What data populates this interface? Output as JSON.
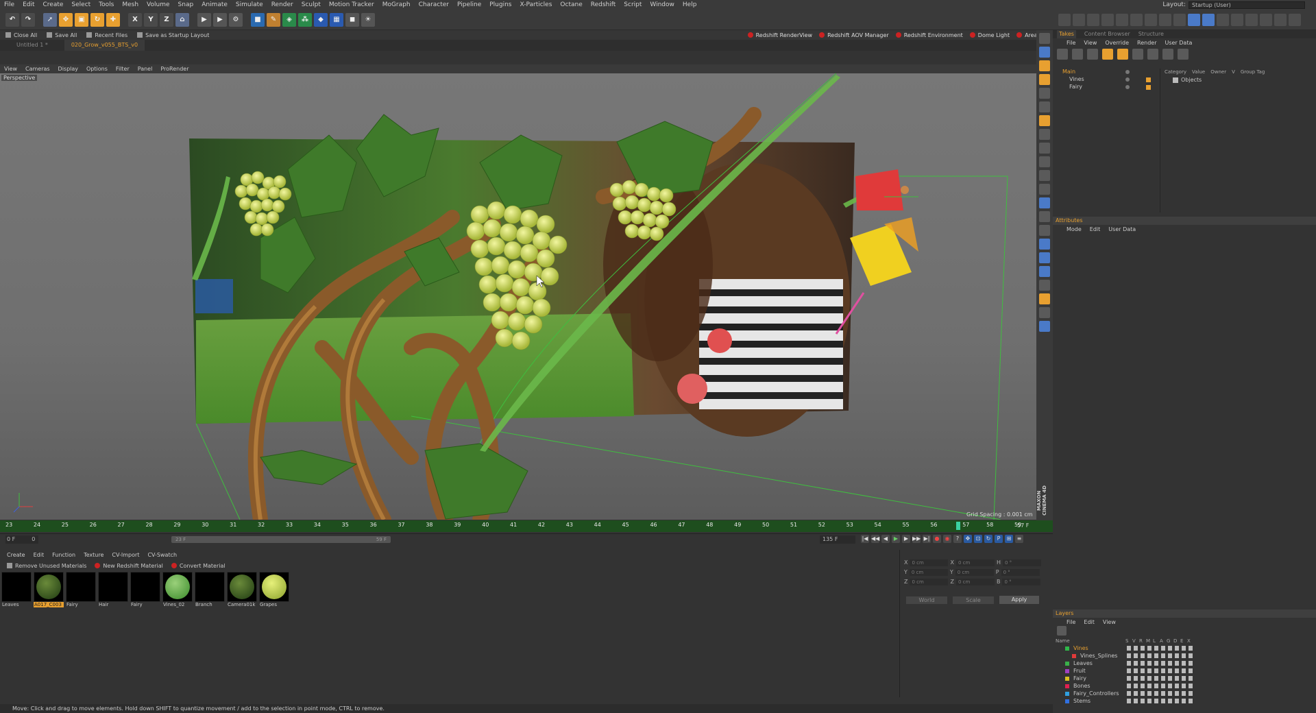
{
  "menu": [
    "File",
    "Edit",
    "Create",
    "Select",
    "Tools",
    "Mesh",
    "Volume",
    "Snap",
    "Animate",
    "Simulate",
    "Render",
    "Sculpt",
    "Motion Tracker",
    "MoGraph",
    "Character",
    "Pipeline",
    "Plugins",
    "X-Particles",
    "Octane",
    "Redshift",
    "Script",
    "Window",
    "Help"
  ],
  "layout": {
    "label": "Layout:",
    "value": "Startup (User)"
  },
  "bar2": {
    "close_all": "Close All",
    "save_all": "Save All",
    "recent_files": "Recent Files",
    "save_startup": "Save as Startup Layout"
  },
  "redshift_buttons": [
    "Redshift RenderView",
    "Redshift AOV Manager",
    "Redshift Environment",
    "Dome Light",
    "Area Light"
  ],
  "doc_tabs": [
    {
      "label": "Untitled 1 *"
    },
    {
      "label": "020_Grow_v055_BTS_v0"
    }
  ],
  "viewport_menu": [
    "View",
    "Cameras",
    "Display",
    "Options",
    "Filter",
    "Panel",
    "ProRender"
  ],
  "viewport_label": "Perspective",
  "grid_spacing": "Grid Spacing : 0.001 cm",
  "timeline": {
    "ticks": [
      "23",
      "24",
      "25",
      "26",
      "27",
      "28",
      "29",
      "30",
      "31",
      "32",
      "33",
      "34",
      "35",
      "36",
      "37",
      "38",
      "39",
      "40",
      "41",
      "42",
      "43",
      "44",
      "45",
      "46",
      "47",
      "48",
      "49",
      "50",
      "51",
      "52",
      "53",
      "54",
      "55",
      "56",
      "57",
      "58",
      "59"
    ],
    "current_frame": "57",
    "end_label": "57 F",
    "start_field": "0 F",
    "start_value": "0",
    "slider_left": "23 F",
    "slider_right": "59 F",
    "end_field": "135 F"
  },
  "material_menu": [
    "Create",
    "Edit",
    "Function",
    "Texture",
    "CV-Import",
    "CV-Swatch"
  ],
  "material_buttons": {
    "remove_unused": "Remove Unused Materials",
    "new_redshift": "New Redshift Material",
    "convert": "Convert Material"
  },
  "materials": [
    {
      "name": "Leaves",
      "swatch": "black"
    },
    {
      "name": "A017_C003",
      "swatch": "moss",
      "selected": true
    },
    {
      "name": "Fairy",
      "swatch": "black"
    },
    {
      "name": "Hair",
      "swatch": "black"
    },
    {
      "name": "Fairy",
      "swatch": "black"
    },
    {
      "name": "Vines_02",
      "swatch": "green"
    },
    {
      "name": "Branch",
      "swatch": "black"
    },
    {
      "name": "Camera01k",
      "swatch": "moss"
    },
    {
      "name": "Grapes",
      "swatch": "lime"
    }
  ],
  "coords": {
    "rows": [
      {
        "a": "X",
        "av": "0 cm",
        "b": "X",
        "bv": "0 cm",
        "c": "H",
        "cv": "0 °"
      },
      {
        "a": "Y",
        "av": "0 cm",
        "b": "Y",
        "bv": "0 cm",
        "c": "P",
        "cv": "0 °"
      },
      {
        "a": "Z",
        "av": "0 cm",
        "b": "Z",
        "bv": "0 cm",
        "c": "B",
        "cv": "0 °"
      }
    ],
    "world": "World",
    "scale": "Scale",
    "apply": "Apply"
  },
  "status": "Move: Click and drag to move elements. Hold down SHIFT to quantize movement / add to the selection in point mode, CTRL to remove.",
  "takes": {
    "tabs": [
      "Takes",
      "Content Browser",
      "Structure"
    ],
    "menu": [
      "File",
      "View",
      "Override",
      "Render",
      "User Data"
    ],
    "tree": [
      {
        "name": "Main",
        "main": true
      },
      {
        "name": "Vines"
      },
      {
        "name": "Fairy"
      }
    ],
    "columns": [
      "Category",
      "Value",
      "Owner",
      "V",
      "Group Tag"
    ],
    "category_item": "Objects"
  },
  "attributes": {
    "title": "Attributes",
    "menu": [
      "Mode",
      "Edit",
      "User Data"
    ]
  },
  "layers": {
    "title": "Layers",
    "menu": [
      "File",
      "Edit",
      "View"
    ],
    "columns": [
      "Name",
      "S",
      "V",
      "R",
      "M",
      "L",
      "A",
      "G",
      "D",
      "E",
      "X"
    ],
    "rows": [
      {
        "name": "Vines",
        "color": "#2fb84a",
        "active": true
      },
      {
        "name": "Vines_Splines",
        "color": "#e03a3a",
        "indent": true
      },
      {
        "name": "Leaves",
        "color": "#3ab04a"
      },
      {
        "name": "Fruit",
        "color": "#a040c0"
      },
      {
        "name": "Fairy",
        "color": "#d8c020"
      },
      {
        "name": "Bones",
        "color": "#e02050"
      },
      {
        "name": "Fairy_Controllers",
        "color": "#30a0e0"
      },
      {
        "name": "Stems",
        "color": "#3070e0"
      }
    ]
  },
  "maxon": "MAXON CINEMA 4D",
  "colors": {
    "accent": "#e8a030",
    "timeline": "#1e4e1e",
    "redshift": "#c62828"
  }
}
